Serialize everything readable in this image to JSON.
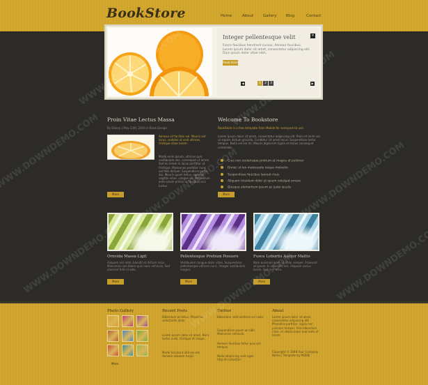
{
  "brand": {
    "logo": "BookStore"
  },
  "nav": {
    "items": [
      "Home",
      "About",
      "Gallery",
      "Blog",
      "Contact"
    ]
  },
  "slider": {
    "title": "Integer pellentesque velit",
    "body": "Fusce faucibus hendrerit cursus. Aenean faucibus. Lorem ipsum dolor sit amet, consectetur adipiscing elit. Duis ipsum dolor vitae nibh.",
    "more_label": "Read more",
    "close_glyph": "×",
    "prev_glyph": "◀",
    "next_glyph": "▶",
    "pages": [
      "1",
      "2",
      "3"
    ],
    "active_page": 1
  },
  "left_post": {
    "title": "Proin Vitae Lectus Massa",
    "meta": "By Danny | May 12th, 2016 in Book Design",
    "intro": "Aenean sit facilisis vel. Mauris est lacus, sodales ut velit ultrices, tristique vitae lorem.",
    "body": "Morbi enim ipsum, ultrices quis vestibulum nec, consequat ut lorem. Sed eu lorem in lacus porttitor ut tristique. Maecenas porttitor nunc vel felis dictum. Suspendisse porta dui. Mauris quam tellus, egestas sagittis vitae, congue sit. Vestibulum ante ipsum primis in faucibus orci luctus.",
    "more_label": "More"
  },
  "welcome": {
    "title": "Welcome To Bookstore",
    "tagline": "BookStore is a free template from Mobile for everyone to use.",
    "body": "Lorem ipsum dolor sit amet, consectetur adipiscing elit. Proin et enim vel ut sapien dictum gravida. Curabitur sit amet lacus. Suspendisse tortor tempus. Nulla vel leo mi. Mauris dignissim ligula at lectus consequat commodo.",
    "bullets": [
      "Cras non scelerisque pretium et magna at pulvinar",
      "Donec ut leo malesuada neque molestie",
      "Suspendisse faucibus laoreet risus",
      "Aliquam tincidunt dolor ut ipsum volutpat ornare",
      "Quisque elementum ipsum ac justo iaculis"
    ],
    "more_label": "More"
  },
  "thumbs": [
    {
      "caption": "Ornvida Massa Ligit",
      "body": "Aliquam nisl nibh, blandit et dictum risus. Maecenas non libero quis nunc vehicula. Sed placerat felis id odio.",
      "more_label": "More",
      "colors": [
        "#8aa63a",
        "#d8e89c",
        "#f6f8ea"
      ]
    },
    {
      "caption": "Pellentesque Pretium Posuere",
      "body": "Vestibulum congue dolor vitae. Suspendisse pellentesque ultrices nunc. Integer vestibulum magna.",
      "more_label": "More",
      "colors": [
        "#5b2f86",
        "#b48ee0",
        "#eee8f8"
      ]
    },
    {
      "caption": "Fusce Lobortis Auctor Mattis",
      "body": "Nam euismod enim at dolor semper. Praesent at ipsum. In convallis nisi. Aliquam varius lorem. Sed non arcu.",
      "more_label": "More",
      "colors": [
        "#3f7f9e",
        "#a8d3e6",
        "#eef7fb"
      ]
    }
  ],
  "footer": {
    "gallery": {
      "title": "Photo Gallery",
      "more_label": "More",
      "tiles": [
        "#e2a12f",
        "#c23c7a",
        "#a0479c",
        "#b65f36",
        "#4f86c6",
        "#7ea63a",
        "#d14d3e",
        "#3b8ca2",
        "#9bb54b"
      ]
    },
    "recent": {
      "title": "Recent Posts",
      "items": [
        "Bibendum ut tellus. Phasellus sollicitudin dolor.",
        "Lorem ipsum dolor sit amet. Nunc tortor nulla, tristique et neque.",
        "Morbi tincidunt ultrices est. Aenean aliquam turpis."
      ]
    },
    "twitter": {
      "title": "Twitter",
      "items": [
        "Bibendum velit eleifend vel nulla.",
        "Suspendisse ipsum ut nibh. Maecenas vehicula.",
        "Aenean faucibus tellus quis est tempus.",
        "Nulla adipiscing velit eget. http://t.co/twitter"
      ]
    },
    "about": {
      "title": "About",
      "body": "Lorem ipsum dolor sit amet, consectetur adipiscing elit. Phasellus porttitor, ligula nec pulvinar tempor, felis bibendum risus, et ullamcorper erat ante et lorem.",
      "credit": "Copyright © 2048 Your Company Name | Template by MOBIE"
    }
  },
  "watermark": {
    "text": "WWW.DOWNDEMO.COM"
  },
  "colors": {
    "gold": "#d2a630",
    "dark": "#2c2b28",
    "accent": "#c9a132"
  }
}
